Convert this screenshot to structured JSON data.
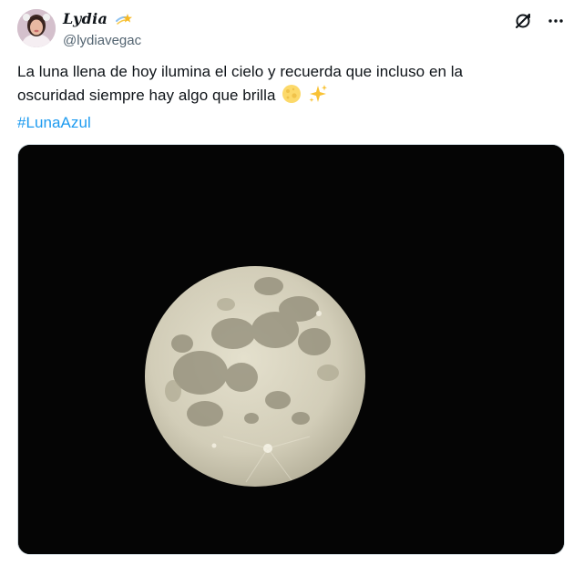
{
  "author": {
    "display_name": "Lydia",
    "handle": "@lydiavegac",
    "badge_icon": "shooting-star-icon",
    "avatar_icon": "profile-photo"
  },
  "actions": {
    "grok_icon": "grok-icon",
    "more_icon": "more-options-icon"
  },
  "tweet": {
    "line1": "La luna llena de hoy ilumina el cielo y recuerda que incluso en la",
    "line2": "oscuridad siempre hay algo que brilla",
    "emojis": [
      "full-moon-icon",
      "sparkles-icon"
    ],
    "hashtag": "#LunaAzul"
  },
  "media": {
    "type": "photo",
    "subject": "full-moon-photo",
    "background_color": "#050505",
    "moon_color": "#d8d4c2"
  },
  "colors": {
    "text": "#0f1419",
    "secondary": "#536471",
    "link": "#1d9bf0"
  }
}
